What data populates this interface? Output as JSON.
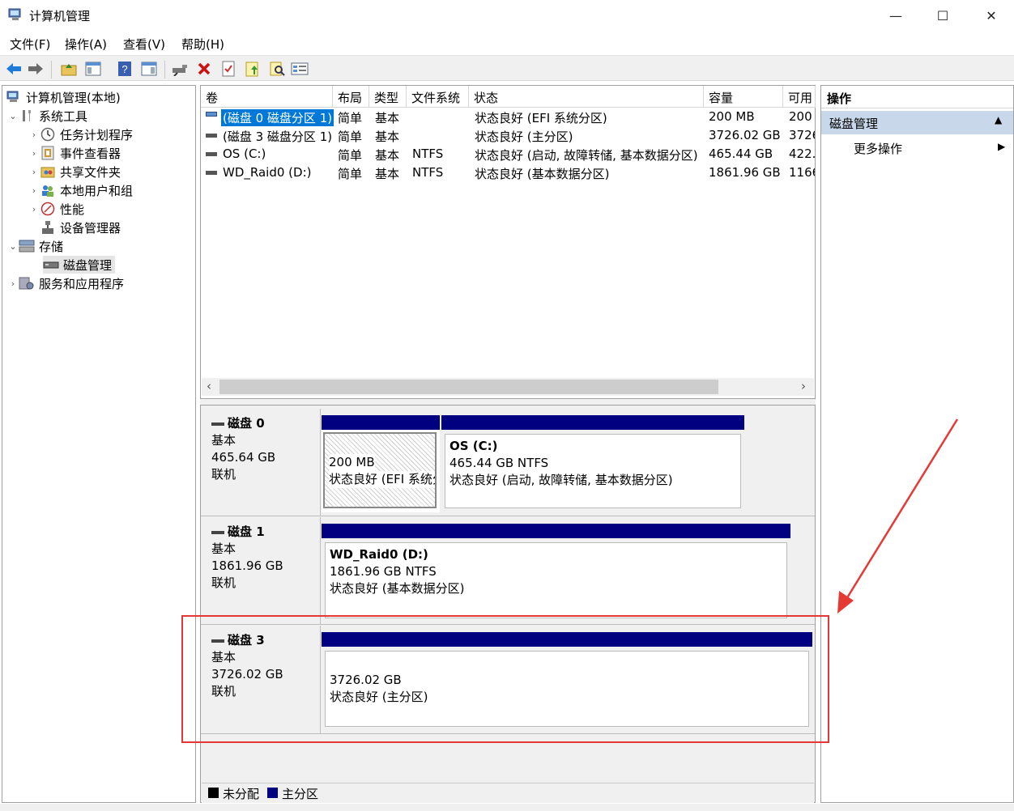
{
  "window": {
    "title": "计算机管理",
    "minimize_glyph": "—",
    "maximize_glyph": "☐",
    "close_glyph": "✕"
  },
  "menu": [
    "文件(F)",
    "操作(A)",
    "查看(V)",
    "帮助(H)"
  ],
  "toolbar_icons": [
    "back-arrow-icon",
    "forward-arrow-icon",
    "up-folder-icon",
    "show-hide-tree-icon",
    "help-icon",
    "show-hide-action-pane-icon",
    "connect-disk-icon",
    "delete-icon",
    "properties-icon",
    "open-folder-icon",
    "search-icon",
    "disk-list-icon"
  ],
  "tree": {
    "root": "计算机管理(本地)",
    "items": [
      {
        "label": "系统工具",
        "icon": "tools-icon"
      },
      {
        "label": "任务计划程序",
        "icon": "clock-icon"
      },
      {
        "label": "事件查看器",
        "icon": "event-viewer-icon"
      },
      {
        "label": "共享文件夹",
        "icon": "shared-folder-icon"
      },
      {
        "label": "本地用户和组",
        "icon": "users-icon"
      },
      {
        "label": "性能",
        "icon": "performance-icon"
      },
      {
        "label": "设备管理器",
        "icon": "device-manager-icon"
      },
      {
        "label": "存储",
        "icon": "storage-icon"
      },
      {
        "label": "磁盘管理",
        "icon": "disk-management-icon"
      },
      {
        "label": "服务和应用程序",
        "icon": "services-icon"
      }
    ]
  },
  "volume_table": {
    "headers": [
      "卷",
      "布局",
      "类型",
      "文件系统",
      "状态",
      "容量",
      "可用"
    ],
    "rows": [
      {
        "volume": "(磁盘 0 磁盘分区 1)",
        "layout": "简单",
        "type": "基本",
        "fs": "",
        "status": "状态良好 (EFI 系统分区)",
        "capacity": "200 MB",
        "free": "200"
      },
      {
        "volume": "(磁盘 3 磁盘分区 1)",
        "layout": "简单",
        "type": "基本",
        "fs": "",
        "status": "状态良好 (主分区)",
        "capacity": "3726.02 GB",
        "free": "3726"
      },
      {
        "volume": "OS (C:)",
        "layout": "简单",
        "type": "基本",
        "fs": "NTFS",
        "status": "状态良好 (启动, 故障转储, 基本数据分区)",
        "capacity": "465.44 GB",
        "free": "422."
      },
      {
        "volume": "WD_Raid0 (D:)",
        "layout": "简单",
        "type": "基本",
        "fs": "NTFS",
        "status": "状态良好 (基本数据分区)",
        "capacity": "1861.96 GB",
        "free": "1166"
      }
    ]
  },
  "scroll": {
    "left": "‹",
    "right": "›"
  },
  "disks": [
    {
      "name": "磁盘 0",
      "type": "基本",
      "size": "465.64 GB",
      "state": "联机",
      "partitions": [
        {
          "title": "",
          "size_line": "200 MB",
          "status": "状态良好 (EFI 系统分区)",
          "hatched": true
        },
        {
          "title": "OS  (C:)",
          "size_line": "465.44 GB NTFS",
          "status": "状态良好 (启动, 故障转储, 基本数据分区)",
          "hatched": false
        }
      ]
    },
    {
      "name": "磁盘 1",
      "type": "基本",
      "size": "1861.96 GB",
      "state": "联机",
      "partitions": [
        {
          "title": "WD_Raid0  (D:)",
          "size_line": "1861.96 GB NTFS",
          "status": "状态良好 (基本数据分区)",
          "hatched": false
        }
      ]
    },
    {
      "name": "磁盘 3",
      "type": "基本",
      "size": "3726.02 GB",
      "state": "联机",
      "partitions": [
        {
          "title": "",
          "size_line": "3726.02 GB",
          "status": "状态良好 (主分区)",
          "hatched": false
        }
      ]
    }
  ],
  "legend": [
    {
      "label": "未分配",
      "color": "#000000"
    },
    {
      "label": "主分区",
      "color": "#000080"
    }
  ],
  "actions": {
    "header": "操作",
    "section": "磁盘管理",
    "items": [
      "更多操作"
    ]
  },
  "colors": {
    "primary_partition": "#000080",
    "selection": "#0078d7",
    "annotation": "#e53935"
  }
}
